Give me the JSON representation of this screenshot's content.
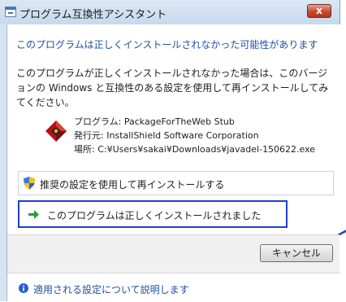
{
  "window": {
    "title": "プログラム互換性アシスタント",
    "close_label": "x"
  },
  "main": {
    "heading": "このプログラムは正しくインストールされなかった可能性があります",
    "description": "このプログラムが正しくインストールされなかった場合は、このバージョンの Windows と互換性のある設定を使用して再インストールしてみてください。"
  },
  "program_info": {
    "program": "プログラム: PackageForTheWeb Stub",
    "publisher": "発行元: InstallShield Software Corporation",
    "location": "場所: C:¥Users¥sakai¥Downloads¥javadel-150622.exe"
  },
  "options": {
    "reinstall_label": "推奨の設定を使用して再インストールする",
    "installed_ok_label": "このプログラムは正しくインストールされました"
  },
  "buttons": {
    "cancel_label": "キャンセル"
  },
  "footer": {
    "help_link": "適用される設定について説明します"
  },
  "colors": {
    "title_bar": "#c6d9ee",
    "heading_text": "#1f4fa8",
    "close_button": "#c44a2e",
    "highlight_border": "#1f3fd0",
    "annotation_arrow": "#2040d0"
  },
  "icons": {
    "title": "window-icon",
    "program": "installshield-app-icon",
    "reinstall": "uac-shield-icon",
    "installed_ok": "green-arrow-icon",
    "help": "info-icon"
  }
}
